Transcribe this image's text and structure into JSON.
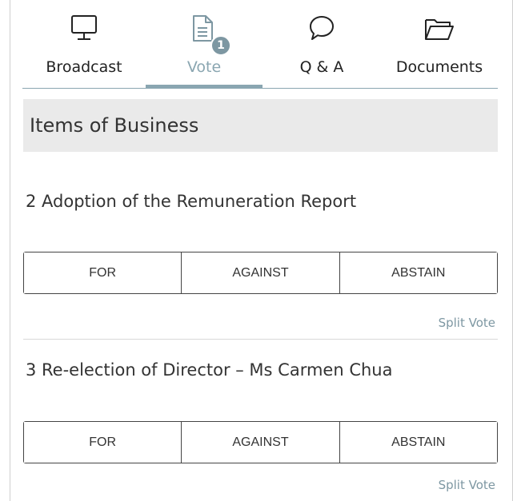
{
  "tabs": [
    {
      "label": "Broadcast",
      "icon": "monitor-icon",
      "active": false
    },
    {
      "label": "Vote",
      "icon": "document-icon",
      "active": true,
      "badge": "1"
    },
    {
      "label": "Q & A",
      "icon": "speech-bubble-icon",
      "active": false
    },
    {
      "label": "Documents",
      "icon": "folder-icon",
      "active": false
    }
  ],
  "section": {
    "title": "Items of Business"
  },
  "items": [
    {
      "title": "2 Adoption of the Remuneration Report",
      "options": [
        "FOR",
        "AGAINST",
        "ABSTAIN"
      ],
      "split_label": "Split Vote"
    },
    {
      "title": "3 Re-election of Director – Ms Carmen Chua",
      "options": [
        "FOR",
        "AGAINST",
        "ABSTAIN"
      ],
      "split_label": "Split Vote"
    }
  ],
  "colors": {
    "accent": "#8aa6b1",
    "header_bg": "#eaeaea",
    "text": "#333333"
  }
}
